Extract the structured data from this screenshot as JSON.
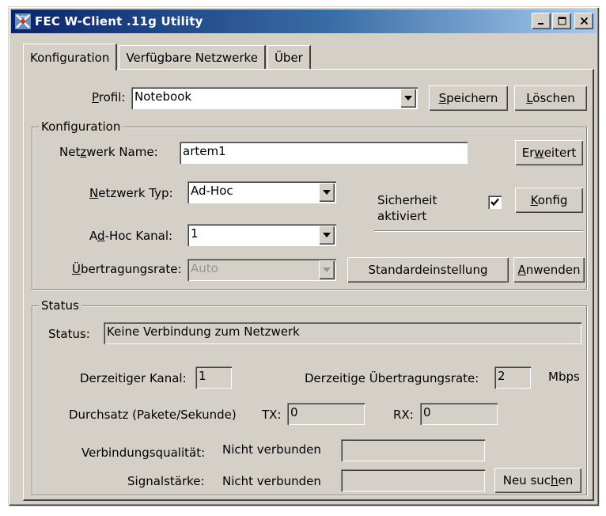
{
  "window": {
    "title": "FEC W-Client .11g Utility"
  },
  "tabs": [
    {
      "label": "Konfiguration",
      "active": true
    },
    {
      "label": "Verfügbare Netzwerke",
      "active": false
    },
    {
      "label": "Über",
      "active": false
    }
  ],
  "profile": {
    "label_pre": "",
    "label_u": "P",
    "label_post": "rofil:",
    "value": "Notebook",
    "save_pre": "",
    "save_u": "S",
    "save_post": "peichern",
    "delete_pre": "",
    "delete_u": "L",
    "delete_post": "öschen"
  },
  "config": {
    "group_title": "Konfiguration",
    "network_name_pre": "Net",
    "network_name_u": "z",
    "network_name_post": "werk Name:",
    "network_name_value": "artem1",
    "advanced_pre": "Er",
    "advanced_u": "w",
    "advanced_post": "eitert",
    "network_type_pre": "",
    "network_type_u": "N",
    "network_type_post": "etzwerk Typ:",
    "network_type_value": "Ad-Hoc",
    "security_label_line1": "Sicherheit",
    "security_label_line2": "aktiviert",
    "security_checked": true,
    "config_btn_pre": "",
    "config_btn_u": "K",
    "config_btn_post": "onfig",
    "adhoc_channel_pre": "A",
    "adhoc_channel_u": "d",
    "adhoc_channel_post": "-Hoc Kanal:",
    "adhoc_channel_value": "1",
    "rate_pre": "",
    "rate_u": "Ü",
    "rate_post": "bertragungsrate:",
    "rate_value": "Auto",
    "defaults_btn": "Standardeinstellung",
    "apply_pre": "",
    "apply_u": "A",
    "apply_post": "nwenden"
  },
  "status": {
    "group_title": "Status",
    "status_label": "Status:",
    "status_value": "Keine Verbindung zum Netzwerk",
    "current_channel_label": "Derzeitiger Kanal:",
    "current_channel_value": "1",
    "current_rate_label": "Derzeitige Übertragungsrate:",
    "current_rate_value": "2",
    "rate_unit": "Mbps",
    "throughput_label": "Durchsatz (Pakete/Sekunde)",
    "tx_label": "TX:",
    "tx_value": "0",
    "rx_label": "RX:",
    "rx_value": "0",
    "link_quality_label": "Verbindungsqualität:",
    "link_quality_value": "Nicht verbunden",
    "signal_label": "Signalstärke:",
    "signal_value": "Nicht verbunden",
    "rescan_pre": "Neu suc",
    "rescan_u": "h",
    "rescan_post": "en"
  }
}
